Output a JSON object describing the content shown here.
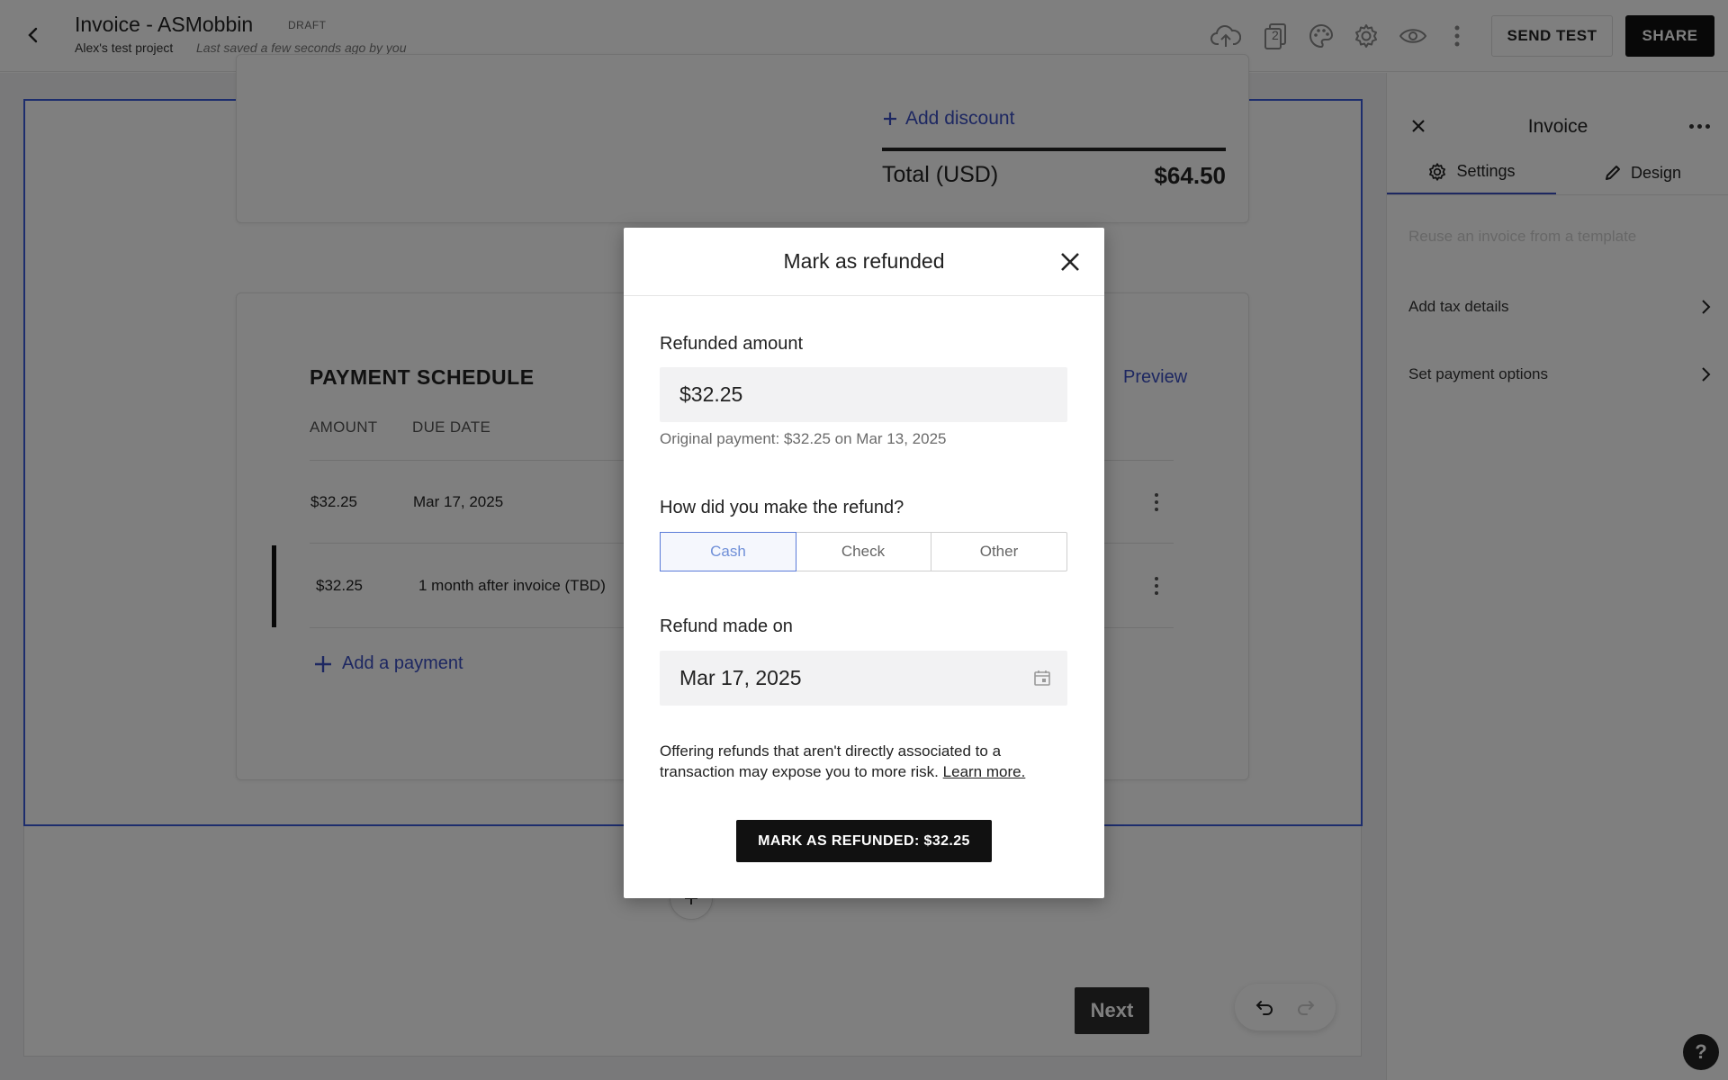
{
  "header": {
    "title": "Invoice - ASMobbin",
    "badge": "DRAFT",
    "project": "Alex's test project",
    "saved": "Last saved a few seconds ago by you",
    "send_test_label": "SEND TEST",
    "share_label": "SHARE",
    "page_count": "2"
  },
  "invoice": {
    "add_discount": "Add discount",
    "total_label": "Total (USD)",
    "total_value": "$64.50"
  },
  "payment_schedule": {
    "title": "PAYMENT SCHEDULE",
    "preview_label": "Preview",
    "columns": [
      "AMOUNT",
      "DUE DATE"
    ],
    "rows": [
      {
        "amount": "$32.25",
        "due": "Mar 17, 2025"
      },
      {
        "amount": "$32.25",
        "due": "1 month after invoice (TBD)"
      }
    ],
    "add_payment": "Add a payment"
  },
  "footer": {
    "next_label": "Next"
  },
  "right_panel": {
    "title": "Invoice",
    "tabs": [
      {
        "label": "Settings",
        "icon": "gear-icon",
        "active": true
      },
      {
        "label": "Design",
        "icon": "pencil-icon",
        "active": false
      }
    ],
    "template_link": "Reuse an invoice from a template",
    "items": [
      {
        "label": "Add tax details"
      },
      {
        "label": "Set payment options"
      }
    ]
  },
  "help_label": "?",
  "modal": {
    "title": "Mark as refunded",
    "amount_label": "Refunded amount",
    "amount_value": "$32.25",
    "original_payment": "Original payment: $32.25 on Mar 13, 2025",
    "method_label": "How did you make the refund?",
    "methods": [
      "Cash",
      "Check",
      "Other"
    ],
    "selected_method": "Cash",
    "date_label": "Refund made on",
    "date_value": "Mar 17, 2025",
    "note": "Offering refunds that aren't directly associated to a transaction may expose you to more risk.",
    "learn_more": "Learn more.",
    "submit_label": "MARK AS REFUNDED: $32.25"
  },
  "colors": {
    "accent": "#3a4fc3",
    "selected_segment": "#5a7bd8",
    "primary_button": "#111111",
    "overlay": "rgba(0,0,0,0.5)"
  }
}
